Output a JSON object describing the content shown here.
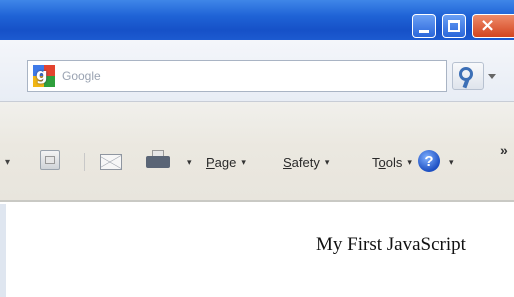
{
  "window": {
    "controls": {
      "minimize_icon": "minimize-icon",
      "maximize_icon": "maximize-icon",
      "close_icon": "close-icon",
      "close_glyph": "×"
    },
    "titlebar_color": "#1f63d6"
  },
  "search": {
    "placeholder": "Google",
    "provider_icon": "google-icon",
    "button_icon": "search-icon"
  },
  "command_bar": {
    "items": [
      {
        "name": "home",
        "icon": "home-icon"
      },
      {
        "name": "mail",
        "icon": "mail-icon"
      },
      {
        "name": "print",
        "icon": "printer-icon"
      },
      {
        "label_prefix": "",
        "label_underlined": "P",
        "label_rest": "age",
        "arrow": "▾"
      },
      {
        "label_prefix": "",
        "label_underlined": "S",
        "label_rest": "afety",
        "arrow": "▾"
      },
      {
        "label_prefix": "T",
        "label_underlined": "o",
        "label_rest": "ols",
        "arrow": "▾"
      }
    ],
    "help_glyph": "?",
    "overflow": "»"
  },
  "page": {
    "text": "My First JavaScript"
  }
}
